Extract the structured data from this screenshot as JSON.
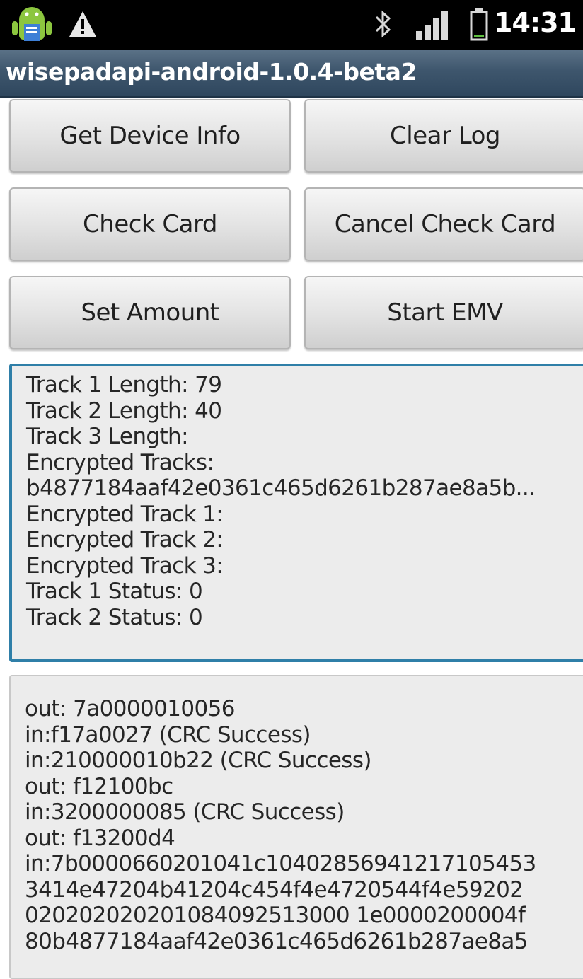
{
  "status_bar": {
    "time": "14:31",
    "icons": [
      "android-notification-icon",
      "warning-icon",
      "bluetooth-icon",
      "signal-icon",
      "battery-icon"
    ]
  },
  "app": {
    "title": "wisepadapi-android-1.0.4-beta2"
  },
  "buttons": {
    "get_device_info": "Get Device Info",
    "clear_log": "Clear Log",
    "check_card": "Check Card",
    "cancel_check_card": "Cancel Check Card",
    "set_amount": "Set Amount",
    "start_emv": "Start EMV"
  },
  "status_text": {
    "lines": [
      "Track 1 Length: 79",
      "Track 2 Length: 40",
      "Track 3 Length:",
      "Encrypted Tracks:",
      "b4877184aaf42e0361c465d6261b287ae8a5b...",
      "Encrypted Track 1:",
      "Encrypted Track 2:",
      "Encrypted Track 3:",
      "Track 1 Status: 0",
      "Track 2 Status: 0"
    ]
  },
  "log_text": {
    "lines": [
      "out: 7a0000010056",
      "in:f17a0027 (CRC Success)",
      "in:210000010b22 (CRC Success)",
      "out: f12100bc",
      "in:3200000085 (CRC Success)",
      "out: f13200d4",
      "in:7b0000660201041c10402856941217105453",
      "3414e47204b41204c454f4e4720544f4e59202",
      "020202020201084092513000 1e0000200004f",
      "80b4877184aaf42e0361c465d6261b287ae8a5"
    ]
  },
  "colors": {
    "title_bar": "#3e566d",
    "focus_border": "#2f7fa8",
    "text_box_bg": "#ececec"
  }
}
